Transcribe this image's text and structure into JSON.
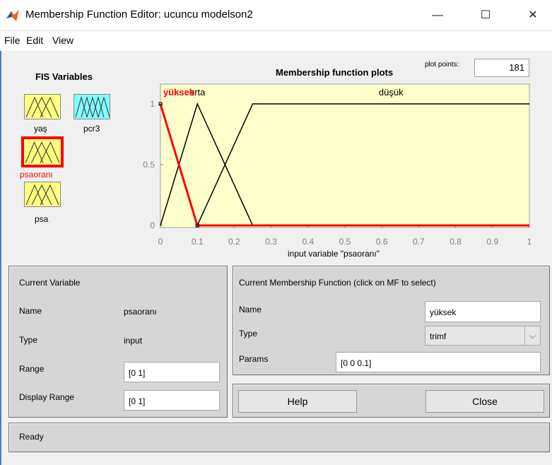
{
  "window": {
    "title": "Membership Function Editor: ucuncu modelson2"
  },
  "menu": {
    "file": "File",
    "edit": "Edit",
    "view": "View"
  },
  "fis": {
    "title": "FIS Variables",
    "variables": [
      {
        "name": "yaş",
        "type": "input"
      },
      {
        "name": "pcr3",
        "type": "output"
      },
      {
        "name": "psaoranı",
        "type": "input",
        "selected": true
      },
      {
        "name": "psa",
        "type": "input"
      }
    ]
  },
  "plot": {
    "title": "Membership function plots",
    "plot_points_label": "plot points:",
    "plot_points_value": "181",
    "xlabel": "input variable \"psaoranı\""
  },
  "chart_data": {
    "type": "line",
    "xlim": [
      0,
      1
    ],
    "ylim": [
      0,
      1
    ],
    "x_ticks": [
      "0",
      "0.1",
      "0.2",
      "0.3",
      "0.4",
      "0.5",
      "0.6",
      "0.7",
      "0.8",
      "0.9",
      "1"
    ],
    "y_ticks": [
      "0",
      "0.5",
      "1"
    ],
    "series": [
      {
        "name": "yüksek",
        "points": [
          [
            0,
            1
          ],
          [
            0.1,
            0
          ]
        ],
        "tail": [
          [
            0.1,
            0
          ],
          [
            1,
            0
          ]
        ],
        "selected": true
      },
      {
        "name": "orta",
        "points": [
          [
            0,
            0
          ],
          [
            0.1,
            1
          ],
          [
            0.25,
            0
          ]
        ],
        "tail": [
          [
            0.25,
            0
          ],
          [
            1,
            0
          ]
        ]
      },
      {
        "name": "düşük",
        "points": [
          [
            0.1,
            0
          ],
          [
            0.25,
            1
          ],
          [
            1,
            1
          ]
        ]
      }
    ],
    "selected_color": "#ff0000",
    "line_color": "#000000"
  },
  "current_variable": {
    "heading": "Current Variable",
    "name_label": "Name",
    "name_value": "psaoranı",
    "type_label": "Type",
    "type_value": "input",
    "range_label": "Range",
    "range_value": "[0 1]",
    "display_range_label": "Display Range",
    "display_range_value": "[0 1]"
  },
  "current_mf": {
    "heading": "Current Membership Function (click on MF to select)",
    "name_label": "Name",
    "name_value": "yüksek",
    "type_label": "Type",
    "type_value": "trimf",
    "params_label": "Params",
    "params_value": "[0 0 0.1]"
  },
  "buttons": {
    "help": "Help",
    "close": "Close"
  },
  "status": "Ready",
  "colors": {
    "selected_var_border": "#ff0000",
    "plot_bg": "#ffffcc",
    "var_box_fill": "#ffff80",
    "output_box_fill": "#80ffff"
  }
}
